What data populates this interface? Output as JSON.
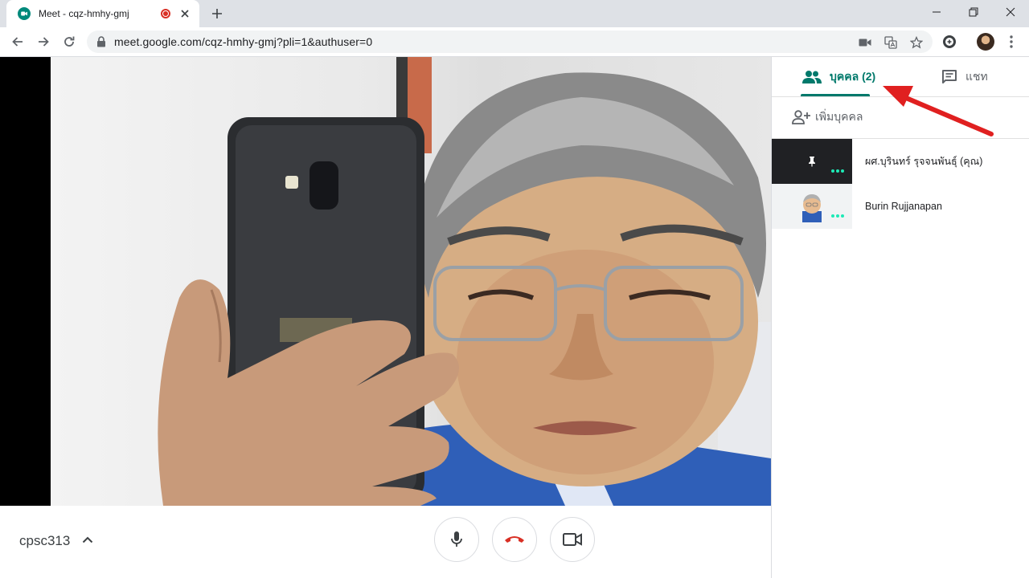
{
  "browser": {
    "tab_title": "Meet - cqz-hmhy-gmj",
    "url": "meet.google.com/cqz-hmhy-gmj?pli=1&authuser=0",
    "icons": [
      "meet-favicon",
      "recording-icon",
      "close-icon",
      "plus-icon",
      "minimize-icon",
      "restore-icon",
      "close-window-icon",
      "back-icon",
      "forward-icon",
      "reload-icon",
      "lock-icon",
      "camera-icon",
      "translate-icon",
      "star-icon",
      "extension-icon",
      "profile-avatar",
      "menu-icon"
    ]
  },
  "meet": {
    "meeting_code": "cpsc313",
    "controls": [
      "mic-icon",
      "hangup-icon",
      "camera-icon"
    ],
    "accent_color": "#00796b",
    "hangup_color": "#d93025"
  },
  "panel": {
    "people_tab": "บุคคล (2)",
    "chat_tab": "แชท",
    "add_people": "เพิ่มบุคคล",
    "participants": [
      {
        "name": "ผศ.บุรินทร์ รุจจนพันธุ์ (คุณ)"
      },
      {
        "name": "Burin Rujjanapan"
      }
    ]
  }
}
